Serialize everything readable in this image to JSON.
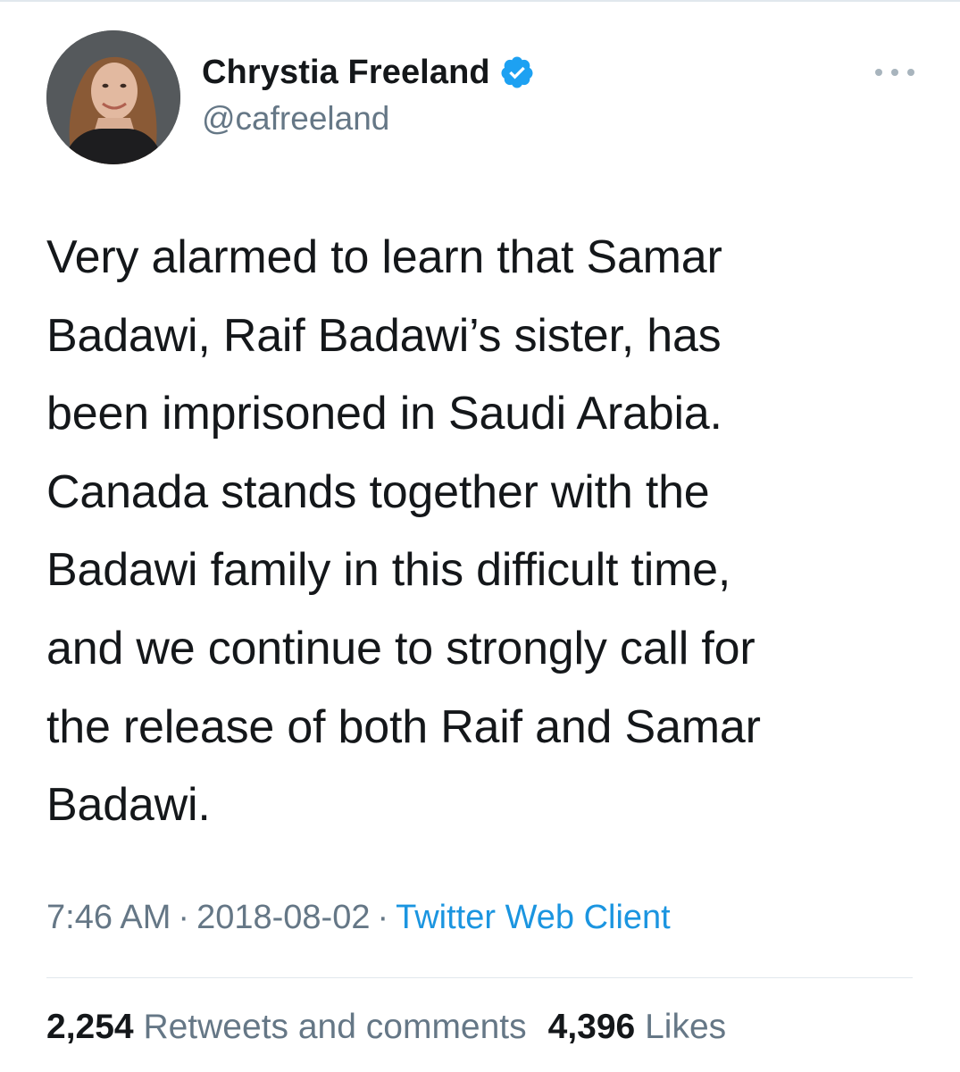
{
  "tweet": {
    "author": {
      "display_name": "Chrystia Freeland",
      "handle": "@cafreeland",
      "verified": true,
      "avatar_icon": "profile-photo"
    },
    "more_icon": "more-horizontal-icon",
    "text": "Very alarmed to learn that Samar\nBadawi, Raif Badawi’s sister, has\nbeen imprisoned in Saudi Arabia.\nCanada stands together with the\nBadawi family in this difficult time,\nand we continue to strongly call for\nthe release of both Raif and Samar\nBadawi.",
    "time": "7:46 AM",
    "date": "2018-08-02",
    "separator": "·",
    "source": "Twitter Web Client",
    "stats": {
      "retweets_count": "2,254",
      "retweets_label": "Retweets and comments",
      "likes_count": "4,396",
      "likes_label": "Likes"
    }
  },
  "colors": {
    "text_primary": "#14171a",
    "text_secondary": "#657786",
    "link": "#1b95e0",
    "verified_badge": "#1da1f2",
    "divider": "#e1e8ed"
  }
}
